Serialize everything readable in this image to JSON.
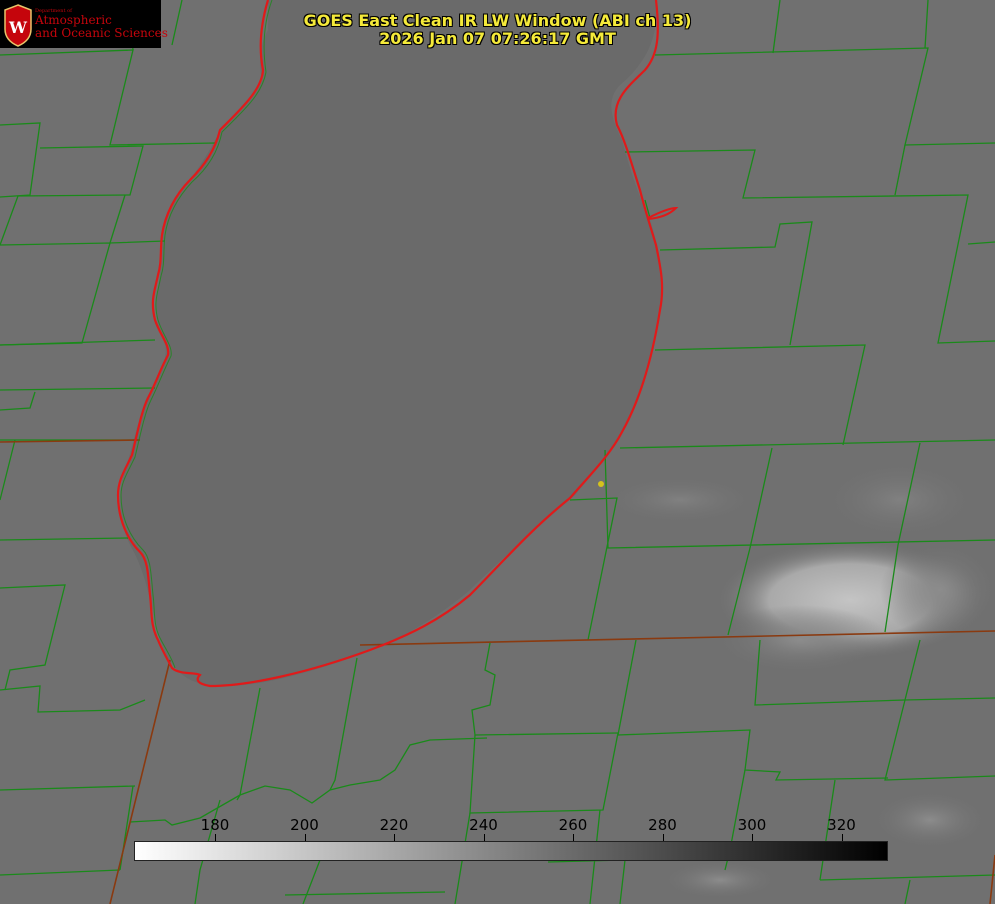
{
  "header": {
    "title_line1": "GOES East Clean IR LW Window (ABI ch 13)",
    "title_line2": "2026 Jan 07 07:26:17 GMT"
  },
  "logo": {
    "small_text": "Department of",
    "line1": "Atmospheric",
    "line2": "and Oceanic Sciences",
    "crest_letter": "W",
    "color": "#c5050c"
  },
  "colorbar": {
    "ticks": [
      "180",
      "200",
      "220",
      "240",
      "260",
      "280",
      "300",
      "320"
    ],
    "gradient": [
      "#ffffff",
      "#000000"
    ]
  },
  "colors": {
    "county_lines": "#1a8a1a",
    "shoreline": "#e01a1a",
    "title": "#f5ea3a",
    "marker": "#d4c21c"
  }
}
